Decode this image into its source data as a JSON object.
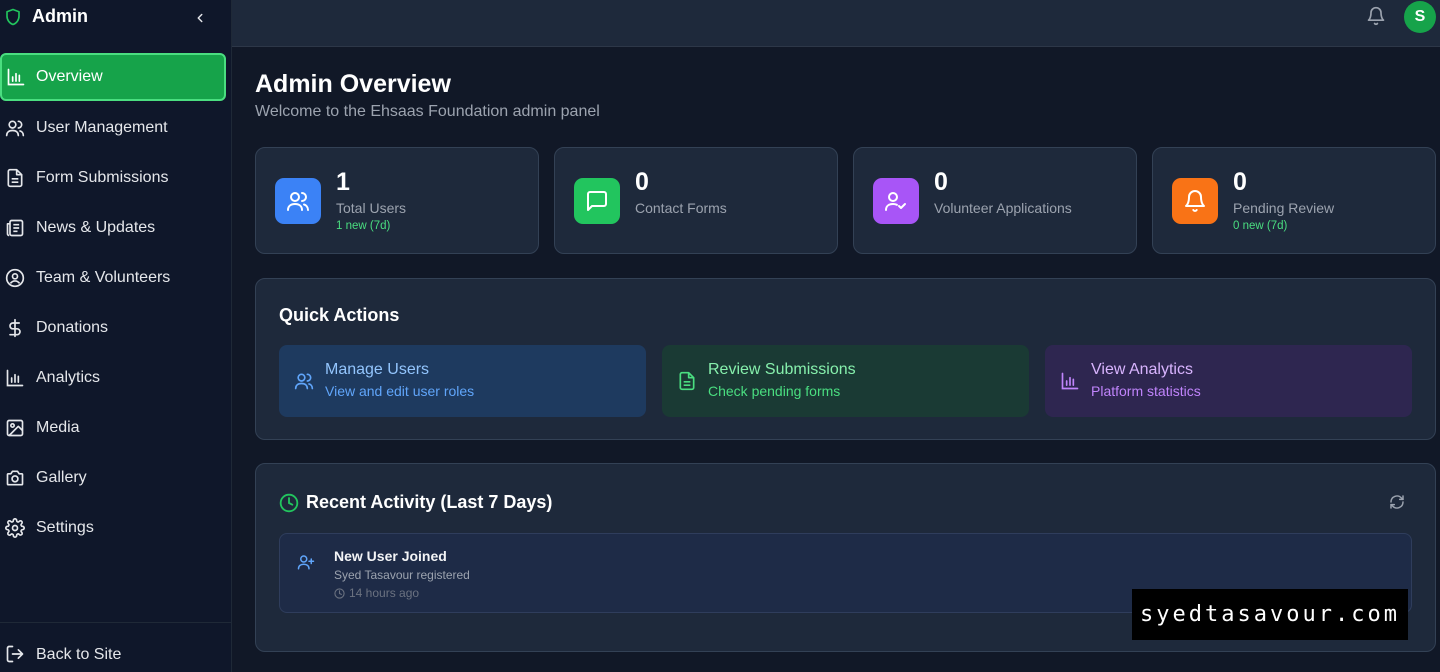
{
  "sidebar": {
    "brand": "Admin",
    "items": [
      {
        "label": "Overview",
        "icon": "bar-chart-icon"
      },
      {
        "label": "User Management",
        "icon": "users-icon"
      },
      {
        "label": "Form Submissions",
        "icon": "document-icon"
      },
      {
        "label": "News & Updates",
        "icon": "newspaper-icon"
      },
      {
        "label": "Team & Volunteers",
        "icon": "user-circle-icon"
      },
      {
        "label": "Donations",
        "icon": "dollar-icon"
      },
      {
        "label": "Analytics",
        "icon": "bar-chart-icon"
      },
      {
        "label": "Media",
        "icon": "image-icon"
      },
      {
        "label": "Gallery",
        "icon": "camera-icon"
      },
      {
        "label": "Settings",
        "icon": "gear-icon"
      }
    ],
    "back_label": "Back to Site"
  },
  "header": {
    "avatar_initial": "S"
  },
  "page": {
    "title": "Admin Overview",
    "subtitle": "Welcome to the Ehsaas Foundation admin panel"
  },
  "stats": [
    {
      "value": "1",
      "label": "Total Users",
      "sub": "1 new (7d)",
      "color": "#3b82f6",
      "icon": "users-icon"
    },
    {
      "value": "0",
      "label": "Contact Forms",
      "sub": "",
      "color": "#22c55e",
      "icon": "message-icon"
    },
    {
      "value": "0",
      "label": "Volunteer Applications",
      "sub": "",
      "color": "#a855f7",
      "icon": "user-check-icon"
    },
    {
      "value": "0",
      "label": "Pending Review",
      "sub": "0 new (7d)",
      "color": "#f97316",
      "icon": "bell-icon"
    }
  ],
  "quick_actions": {
    "title": "Quick Actions",
    "items": [
      {
        "title": "Manage Users",
        "subtitle": "View and edit user roles"
      },
      {
        "title": "Review Submissions",
        "subtitle": "Check pending forms"
      },
      {
        "title": "View Analytics",
        "subtitle": "Platform statistics"
      }
    ]
  },
  "recent_activity": {
    "title": "Recent Activity (Last 7 Days)",
    "items": [
      {
        "title": "New User Joined",
        "subtitle": "Syed Tasavour registered",
        "time": "14 hours ago"
      }
    ]
  },
  "watermark": "syedtasavour.com",
  "colors": {
    "accent": "#16a34a",
    "background": "#111827",
    "card": "#1e293b"
  }
}
